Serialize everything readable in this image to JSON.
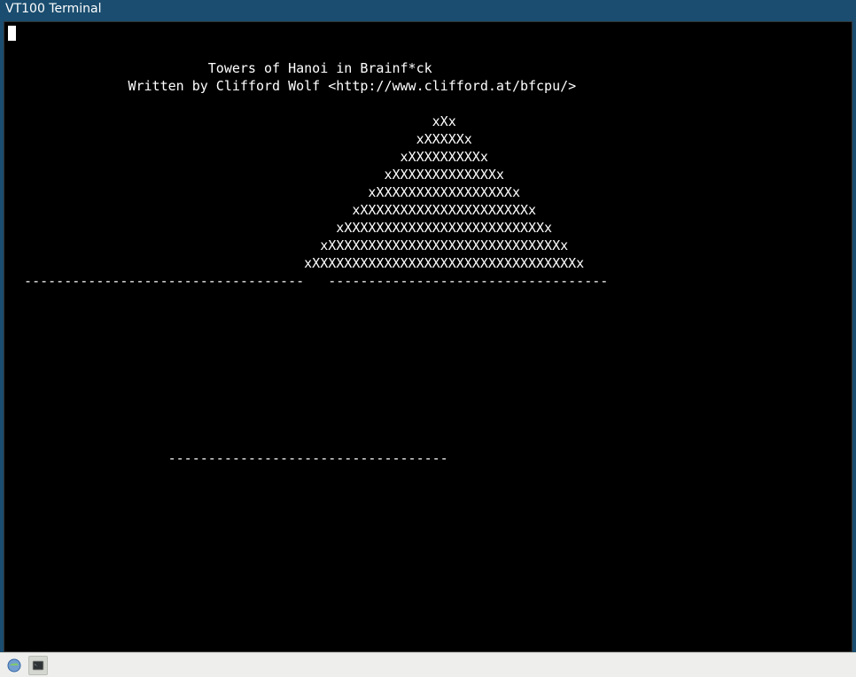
{
  "title_bar": {
    "title": "VT100 Terminal"
  },
  "terminal": {
    "lines": [
      "",
      "",
      "                         Towers of Hanoi in Brainf*ck",
      "               Written by Clifford Wolf <http://www.clifford.at/bfcpu/>",
      "",
      "                                                     xXx",
      "                                                   xXXXXXx",
      "                                                 xXXXXXXXXXx",
      "                                               xXXXXXXXXXXXXXx",
      "                                             xXXXXXXXXXXXXXXXXXx",
      "                                           xXXXXXXXXXXXXXXXXXXXXXx",
      "                                         xXXXXXXXXXXXXXXXXXXXXXXXXXx",
      "                                       xXXXXXXXXXXXXXXXXXXXXXXXXXXXXXx",
      "                                     xXXXXXXXXXXXXXXXXXXXXXXXXXXXXXXXXXx",
      "  -----------------------------------   -----------------------------------",
      "",
      "",
      "",
      "",
      "",
      "",
      "",
      "",
      "",
      "                    -----------------------------------"
    ]
  },
  "taskbar": {
    "show_desktop_tooltip": "Show Desktop",
    "app1_tooltip": "Terminal"
  }
}
